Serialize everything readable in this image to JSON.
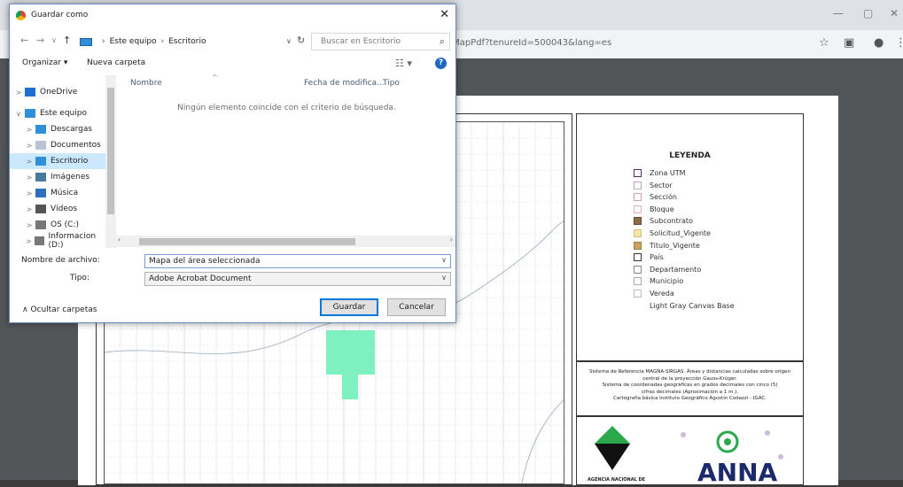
{
  "browser": {
    "address_text": "etMapPdf?tenureId=500043&lang=es",
    "win_minimize": "—",
    "win_restore": "▢",
    "win_close": "✕"
  },
  "dialog": {
    "title": "Guardar como",
    "close_label": "✕",
    "breadcrumb": [
      "Este equipo",
      "Escritorio"
    ],
    "search_placeholder": "Buscar en Escritorio",
    "organize_label": "Organizar ▾",
    "new_folder_label": "Nueva carpeta",
    "nav_items": [
      {
        "label": "OneDrive",
        "icon": "cloud-icon",
        "chevron": ">"
      },
      {
        "label": "Este equipo",
        "icon": "computer-icon",
        "chevron": "∨"
      },
      {
        "label": "Descargas",
        "icon": "download-icon",
        "chevron": ">"
      },
      {
        "label": "Documentos",
        "icon": "document-icon",
        "chevron": ">"
      },
      {
        "label": "Escritorio",
        "icon": "desktop-icon",
        "chevron": ">",
        "selected": true
      },
      {
        "label": "Imágenes",
        "icon": "image-icon",
        "chevron": ">"
      },
      {
        "label": "Música",
        "icon": "music-icon",
        "chevron": ">"
      },
      {
        "label": "Vídeos",
        "icon": "video-icon",
        "chevron": ">"
      },
      {
        "label": "OS (C:)",
        "icon": "drive-icon",
        "chevron": ">"
      },
      {
        "label": "Informacion (D:)",
        "icon": "drive-icon",
        "chevron": ">"
      }
    ],
    "columns": {
      "name": "Nombre",
      "date": "Fecha de modifica...",
      "type": "Tipo"
    },
    "empty_message": "Ningún elemento coincide con el criterio de búsqueda.",
    "filename_label": "Nombre de archivo:",
    "filename_value": "Mapa del área seleccionada",
    "type_label": "Tipo:",
    "type_value": "Adobe Acrobat Document",
    "hide_folders_label": "∧  Ocultar carpetas",
    "save_label": "Guardar",
    "cancel_label": "Cancelar"
  },
  "pdf": {
    "legend_title": "LEYENDA",
    "legend_items": [
      {
        "label": "Zona UTM",
        "color": "#ffffff",
        "border": "#5a2a6a"
      },
      {
        "label": "Sector",
        "color": "#ffffff",
        "border": "#c9a0c0"
      },
      {
        "label": "Sección",
        "color": "#ffffff",
        "border": "#d0a0b0"
      },
      {
        "label": "Bloque",
        "color": "#ffffff",
        "border": "#e0b0c0"
      },
      {
        "label": "Subcontrato",
        "color": "#8b6b4a",
        "border": "#6b4b2a"
      },
      {
        "label": "Solicitud_Vigente",
        "color": "#f6e3a8",
        "border": "#d8c080"
      },
      {
        "label": "Titulo_Vigente",
        "color": "#c8a060",
        "border": "#a08040"
      },
      {
        "label": "País",
        "color": "#ffffff",
        "border": "#333333"
      },
      {
        "label": "Departamento",
        "color": "#ffffff",
        "border": "#888888"
      },
      {
        "label": "Municipio",
        "color": "#ffffff",
        "border": "#aaaaaa"
      },
      {
        "label": "Vereda",
        "color": "#ffffff",
        "border": "#bbbbbb"
      },
      {
        "label": "Light Gray Canvas Base",
        "color": "",
        "border": ""
      }
    ],
    "ref_lines": [
      "Sistema de Referencia MAGNA-SIRGAS. Áreas y distancias calculadas sobre origen",
      "central de la proyección Gauss-Krüger.",
      "Sistema de coordenadas geográficas en grados decimales con cinco (5)",
      "cifras decimales (Aproximación a 1 m.).",
      "Cartografía básica Instituto Geográfico Agustín Codazzi - IGAC."
    ],
    "agency_text": "AGENCIA NACIONAL DE",
    "anna_logo_text": "ANNA",
    "parcel_color": "#7ff0c0"
  }
}
